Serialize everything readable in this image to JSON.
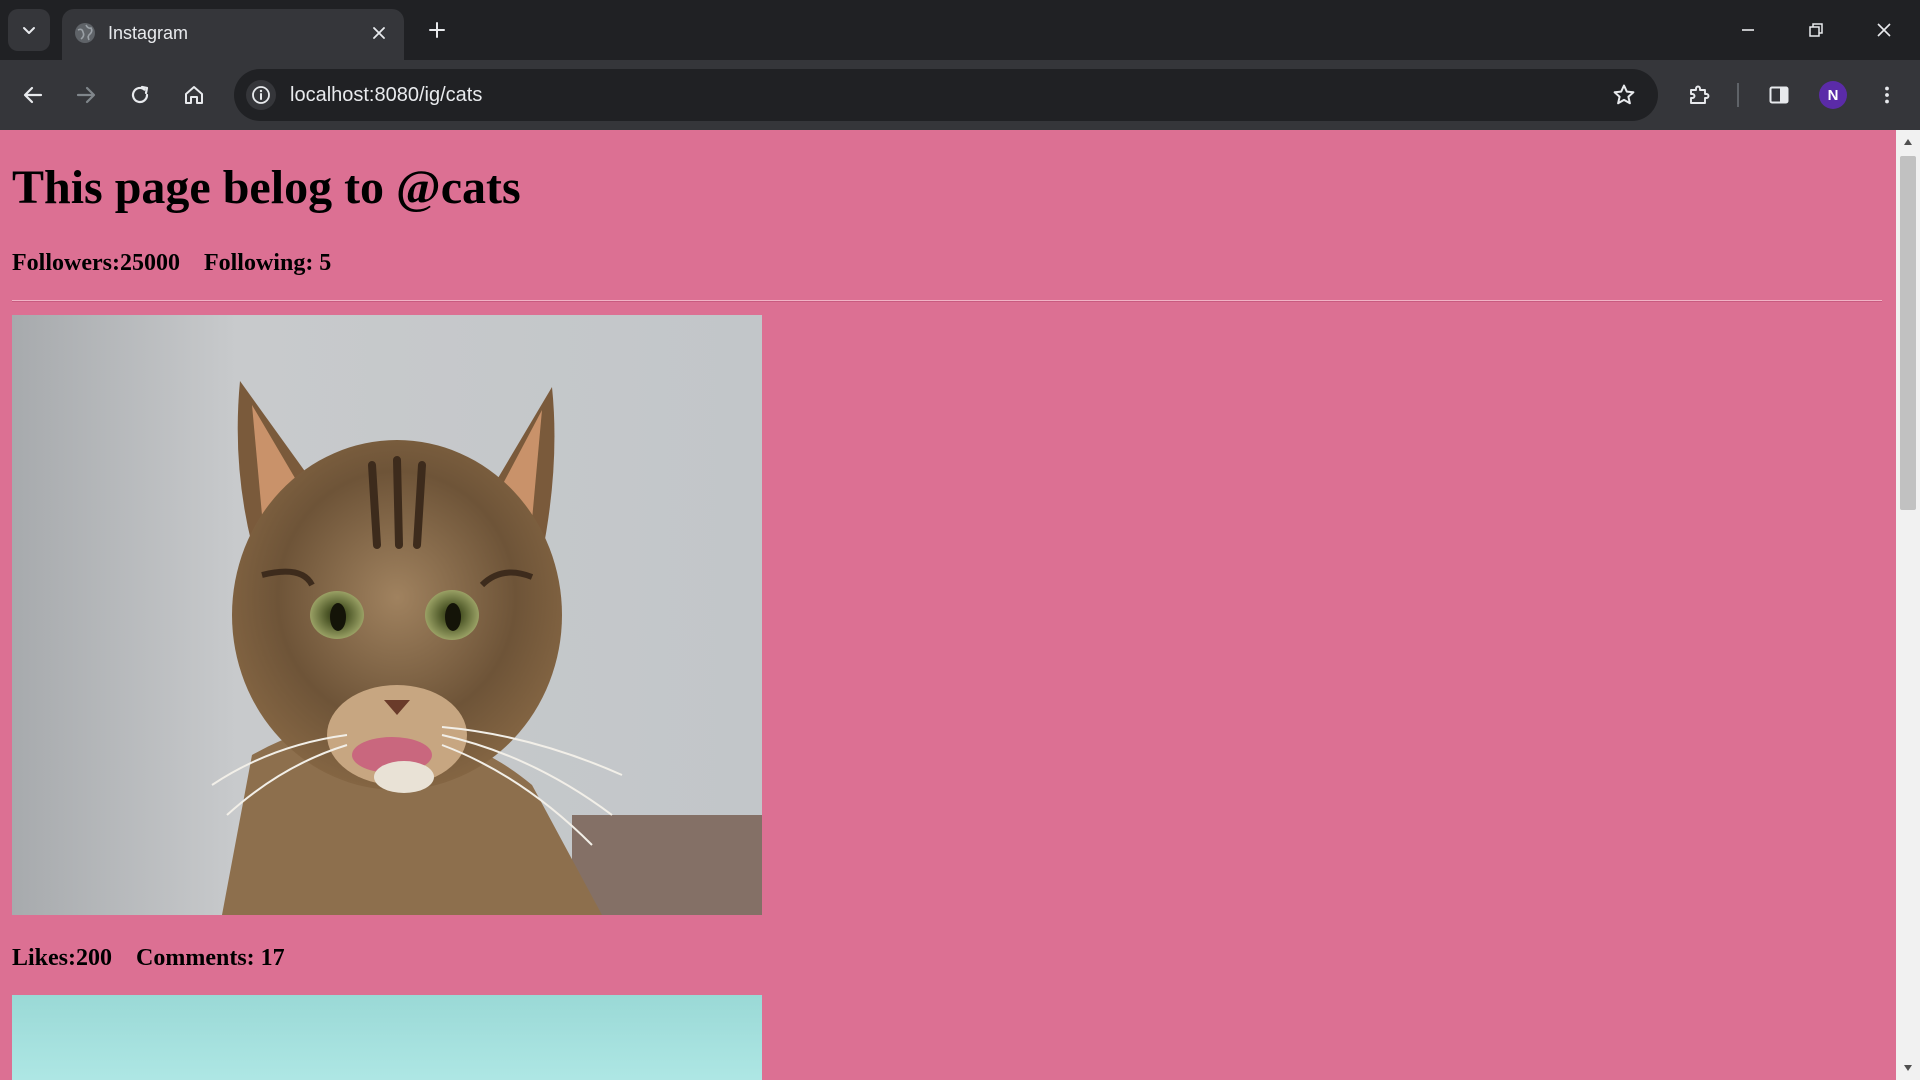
{
  "browser": {
    "tab": {
      "title": "Instagram"
    },
    "url": "localhost:8080/ig/cats",
    "profile_initial": "N",
    "icons": {
      "tab_search": "chevron-down-icon",
      "favicon": "globe-icon",
      "close": "close-icon",
      "new_tab": "plus-icon",
      "minimize": "minimize-icon",
      "restore": "restore-icon",
      "window_close": "close-icon",
      "back": "arrow-left-icon",
      "forward": "arrow-right-icon",
      "reload": "reload-icon",
      "home": "home-icon",
      "site_info": "info-icon",
      "bookmark": "star-icon",
      "extensions": "puzzle-icon",
      "side_panel": "side-panel-icon",
      "menu": "kebab-menu-icon"
    },
    "colors": {
      "frame": "#202124",
      "toolbar": "#35363a",
      "avatar": "#5b2ba8"
    }
  },
  "page": {
    "background": "#dc7093",
    "title": "This page belog to @cats",
    "followers": "Followers:25000",
    "following": "Following: 5",
    "posts": [
      {
        "image": "cat-photo",
        "likes": "Likes:200",
        "comments": "Comments: 17"
      },
      {
        "image": "teal-photo"
      }
    ]
  }
}
